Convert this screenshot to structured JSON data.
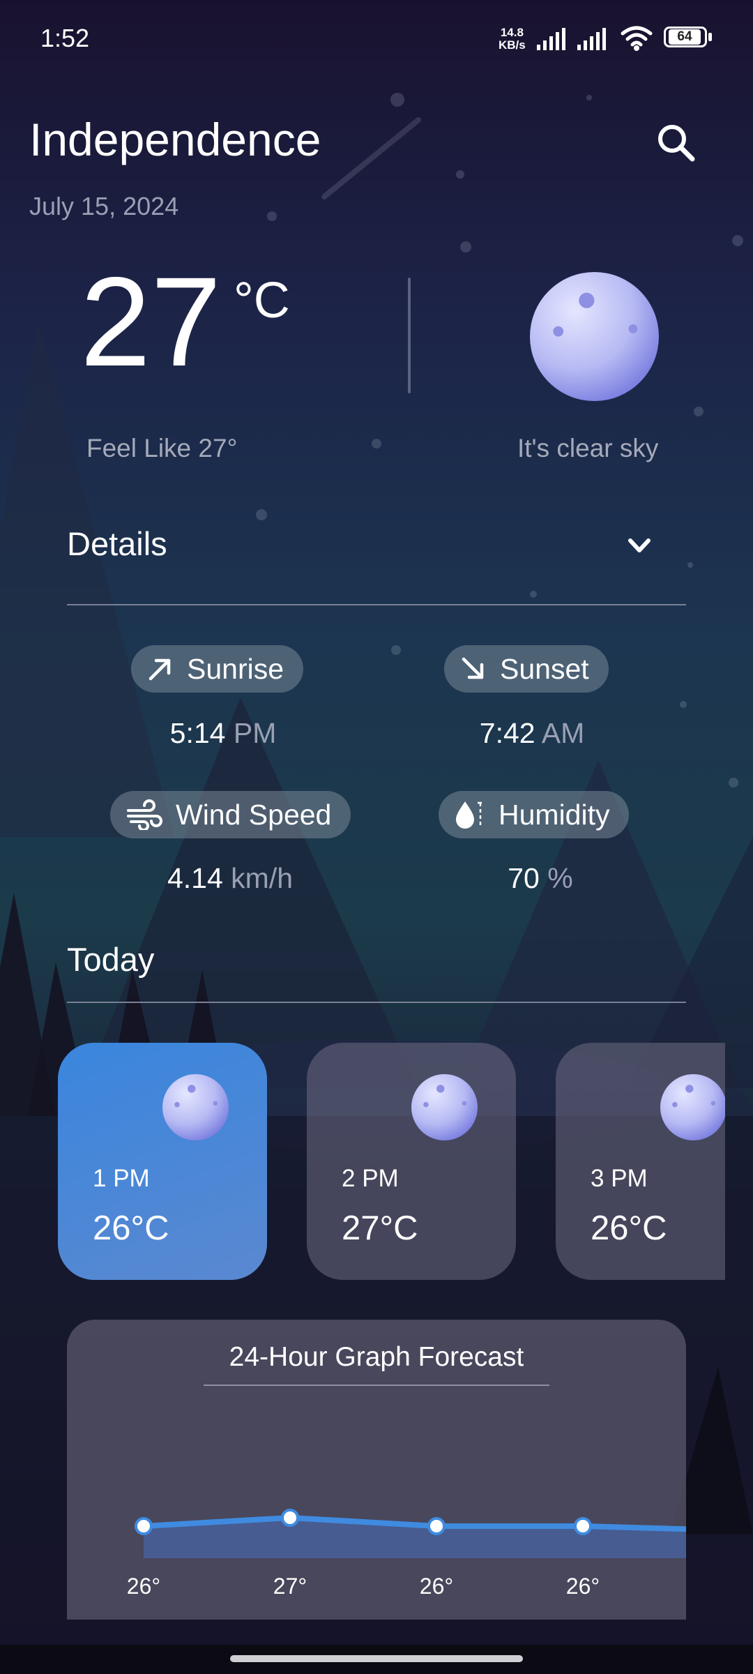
{
  "status_bar": {
    "time": "1:52",
    "net_speed_value": "14.8",
    "net_speed_unit": "KB/s",
    "battery": "64"
  },
  "header": {
    "city": "Independence",
    "date": "July 15, 2024",
    "search_icon": "search-icon"
  },
  "current": {
    "temperature": "27",
    "unit": "°C",
    "feels_like": "Feel Like 27°",
    "condition": "It's clear sky",
    "condition_icon": "moon-icon"
  },
  "details": {
    "title": "Details",
    "toggle_icon": "chevron-down-icon",
    "sunrise": {
      "label": "Sunrise",
      "value": "5:14",
      "unit": "PM",
      "icon": "arrow-up-right-icon"
    },
    "sunset": {
      "label": "Sunset",
      "value": "7:42",
      "unit": "AM",
      "icon": "arrow-down-right-icon"
    },
    "wind": {
      "label": "Wind Speed",
      "value": "4.14",
      "unit": "km/h",
      "icon": "wind-icon"
    },
    "humidity": {
      "label": "Humidity",
      "value": "70",
      "unit": "%",
      "icon": "water-drop-icon"
    }
  },
  "today": {
    "title": "Today",
    "hours": [
      {
        "time": "1 PM",
        "temp": "26°C",
        "active": true
      },
      {
        "time": "2 PM",
        "temp": "27°C",
        "active": false
      },
      {
        "time": "3 PM",
        "temp": "26°C",
        "active": false
      }
    ]
  },
  "graph": {
    "title": "24-Hour Graph Forecast"
  },
  "chart_data": {
    "type": "area",
    "title": "24-Hour Graph Forecast",
    "x": [
      "1",
      "2",
      "3",
      "4"
    ],
    "values": [
      26,
      27,
      26,
      26
    ],
    "labels": [
      "26°",
      "27°",
      "26°",
      "26°"
    ],
    "color": "#3f8be0"
  },
  "colors": {
    "accent": "#3a86de",
    "muted_text": "#9aa0b3",
    "card": "#5f5c70"
  }
}
